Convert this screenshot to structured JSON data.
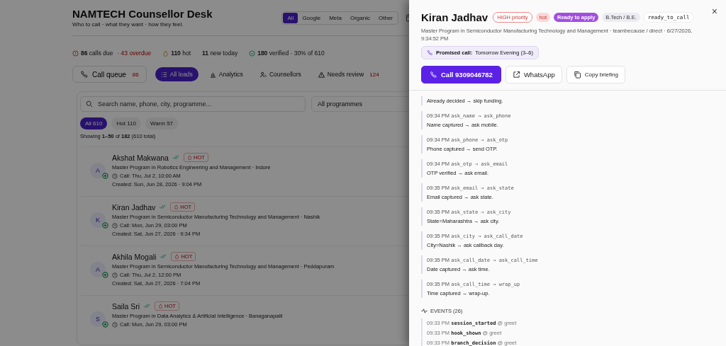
{
  "header": {
    "title": "NAMTECH Counsellor Desk",
    "subtitle": "Who to call · what they want · how they feel.",
    "sources": [
      {
        "label": "All",
        "selected": true
      },
      {
        "label": "Google",
        "selected": false
      },
      {
        "label": "Meta",
        "selected": false
      },
      {
        "label": "Organic",
        "selected": false
      },
      {
        "label": "Other",
        "selected": false
      }
    ]
  },
  "stats": [
    {
      "kind": "due",
      "text": "**86** calls due",
      "extra": "· 43 overdue"
    },
    {
      "kind": "hot",
      "text": "**110** hot"
    },
    {
      "kind": "new",
      "text": "**11** new today"
    },
    {
      "kind": "verified",
      "text": "**180** verified · 30% of 610"
    }
  ],
  "call_queue": {
    "label": "Call queue",
    "count": "86"
  },
  "tabs": [
    {
      "label": "All leads",
      "kind": "list",
      "selected": true
    },
    {
      "label": "Analytics",
      "kind": "chart",
      "selected": false
    },
    {
      "label": "Counsellors",
      "kind": "people",
      "selected": false
    },
    {
      "label": "Needs review",
      "kind": "warning",
      "count": "124",
      "selected": false
    }
  ],
  "search": {
    "placeholder": "Search name, phone, city, programme..."
  },
  "programme_filter": {
    "value": "All programmes"
  },
  "chips": [
    {
      "label": "All",
      "count": "610",
      "selected": true
    },
    {
      "label": "Hot",
      "count": "110",
      "selected": false
    },
    {
      "label": "Warm",
      "count": "57",
      "selected": false
    }
  ],
  "showing": "Showing **1–50** of **182** (610 total)",
  "leads": [
    {
      "initial": "A",
      "name": "Akshat Makwana",
      "badge": "HOT",
      "programme": "Master Program in Robotics Engineering and Management · Indore",
      "call": "Call: Thu, Jul 2, 10:00 AM",
      "created": "Created: Sun, Jun 28, 2026 · 9:04 PM"
    },
    {
      "initial": "K",
      "name": "Kiran Jadhav",
      "badge": "HOT",
      "programme": "Master Program in Semiconductor Manufacturing Technology and Management · Nashik",
      "call": "Call: Mon, Jun 29, 03:00 PM",
      "created": "Created: Sat, Jun 27, 2026 · 9:34 PM"
    },
    {
      "initial": "A",
      "name": "Akhila Mogali",
      "badge": "HOT",
      "programme": "Master Program in Semiconductor Manufacturing Technology and Management · Peddapuram",
      "call": "Call: Thu, Jul 2, 12:00 PM",
      "created": "Created: Sat, Jun 27, 2026 · 7:04 PM"
    },
    {
      "initial": "S",
      "name": "Saila Sri",
      "badge": "HOT",
      "programme": "Master Program in Data Analytics & Artificial Intelligence · Banaganapalli",
      "call": "Call: Mon, Jun 29, 03:00 PM"
    }
  ],
  "drawer": {
    "name": "Kiran Jadhav",
    "close": "×",
    "badges": [
      {
        "label": "HIGH priority",
        "kind": "priority"
      },
      {
        "label": "hot",
        "kind": "temperature"
      },
      {
        "label": "Ready to apply",
        "kind": "stage"
      },
      {
        "label": "B.Tech / B.E.",
        "kind": "education"
      },
      {
        "label": "ready_to_call",
        "kind": "status"
      }
    ],
    "subtitle": "Master Program in Semiconductor Manufacturing Technology and Management · teambecause / direct · 6/27/2026, 9:34:52 PM",
    "promised_call": {
      "label": "Promised call:",
      "value": "Tomorrow Evening (3–6)"
    },
    "actions": [
      {
        "label": "Call 9309046782",
        "kind": "call"
      },
      {
        "label": "WhatsApp",
        "kind": "whatsapp"
      },
      {
        "label": "Copy briefing",
        "kind": "copy"
      }
    ],
    "transitions": [
      {
        "text": "Already decided → skip funding."
      },
      {
        "time": "09:34 PM",
        "step": "ask_name → ask_phone",
        "text": "Name captured → ask mobile."
      },
      {
        "time": "09:34 PM",
        "step": "ask_phone → ask_otp",
        "text": "Phone captured → send OTP."
      },
      {
        "time": "09:34 PM",
        "step": "ask_otp → ask_email",
        "text": "OTP verified → ask email."
      },
      {
        "time": "09:35 PM",
        "step": "ask_email → ask_state",
        "text": "Email captured → ask state."
      },
      {
        "time": "09:35 PM",
        "step": "ask_state → ask_city",
        "text": "State=Maharashtra → ask city."
      },
      {
        "time": "09:35 PM",
        "step": "ask_city → ask_call_date",
        "text": "City=Nashik → ask callback day."
      },
      {
        "time": "09:35 PM",
        "step": "ask_call_date → ask_call_time",
        "text": "Date captured → ask time."
      },
      {
        "time": "09:35 PM",
        "step": "ask_call_time → wrap_up",
        "text": "Time captured → wrap-up."
      }
    ],
    "events_title": "EVENTS (26)",
    "events": [
      {
        "time": "09:33 PM",
        "name": "session_started",
        "node": "@ greet"
      },
      {
        "time": "09:33 PM",
        "name": "hook_shown",
        "node": "@ greet"
      },
      {
        "time": "09:33 PM",
        "name": "branch_decision",
        "node": "@ greet"
      }
    ]
  }
}
